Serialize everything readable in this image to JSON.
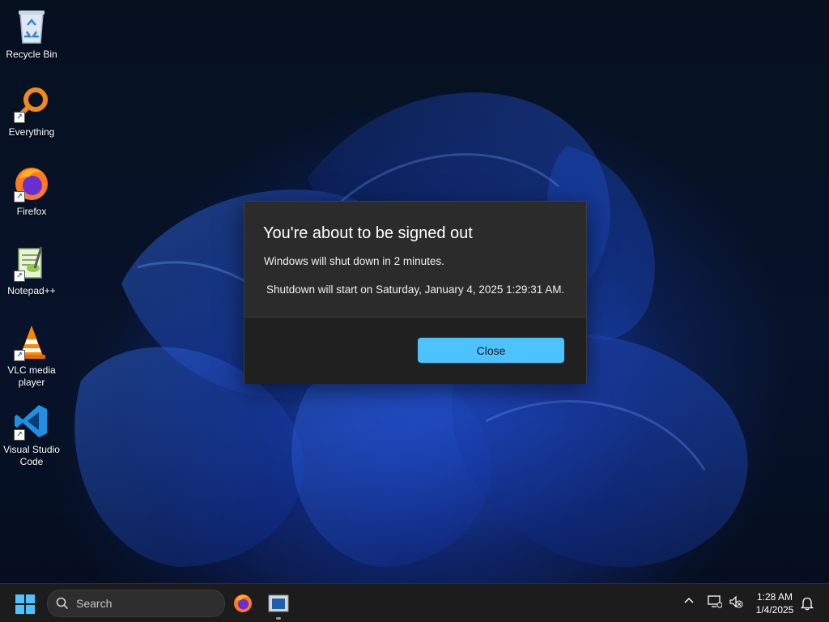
{
  "desktop": {
    "icons": [
      {
        "label": "Recycle Bin",
        "icon": "recycle-bin-icon"
      },
      {
        "label": "Everything",
        "icon": "everything-search-icon"
      },
      {
        "label": "Firefox",
        "icon": "firefox-icon"
      },
      {
        "label": "Notepad++",
        "icon": "notepad-plus-plus-icon"
      },
      {
        "label": "VLC media player",
        "icon": "vlc-cone-icon"
      },
      {
        "label": "Visual Studio Code",
        "icon": "vscode-icon"
      }
    ]
  },
  "dialog": {
    "title": "You're about to be signed out",
    "message": "Windows will shut down in 2 minutes.",
    "detail": "Shutdown will start on Saturday, January 4, 2025 1:29:31 AM.",
    "close_label": "Close",
    "accent": "#4cc2ff"
  },
  "taskbar": {
    "search_placeholder": "Search",
    "clock_time": "1:28 AM",
    "clock_date": "1/4/2025",
    "pinned": [
      "firefox-icon",
      "window-app-icon"
    ]
  }
}
